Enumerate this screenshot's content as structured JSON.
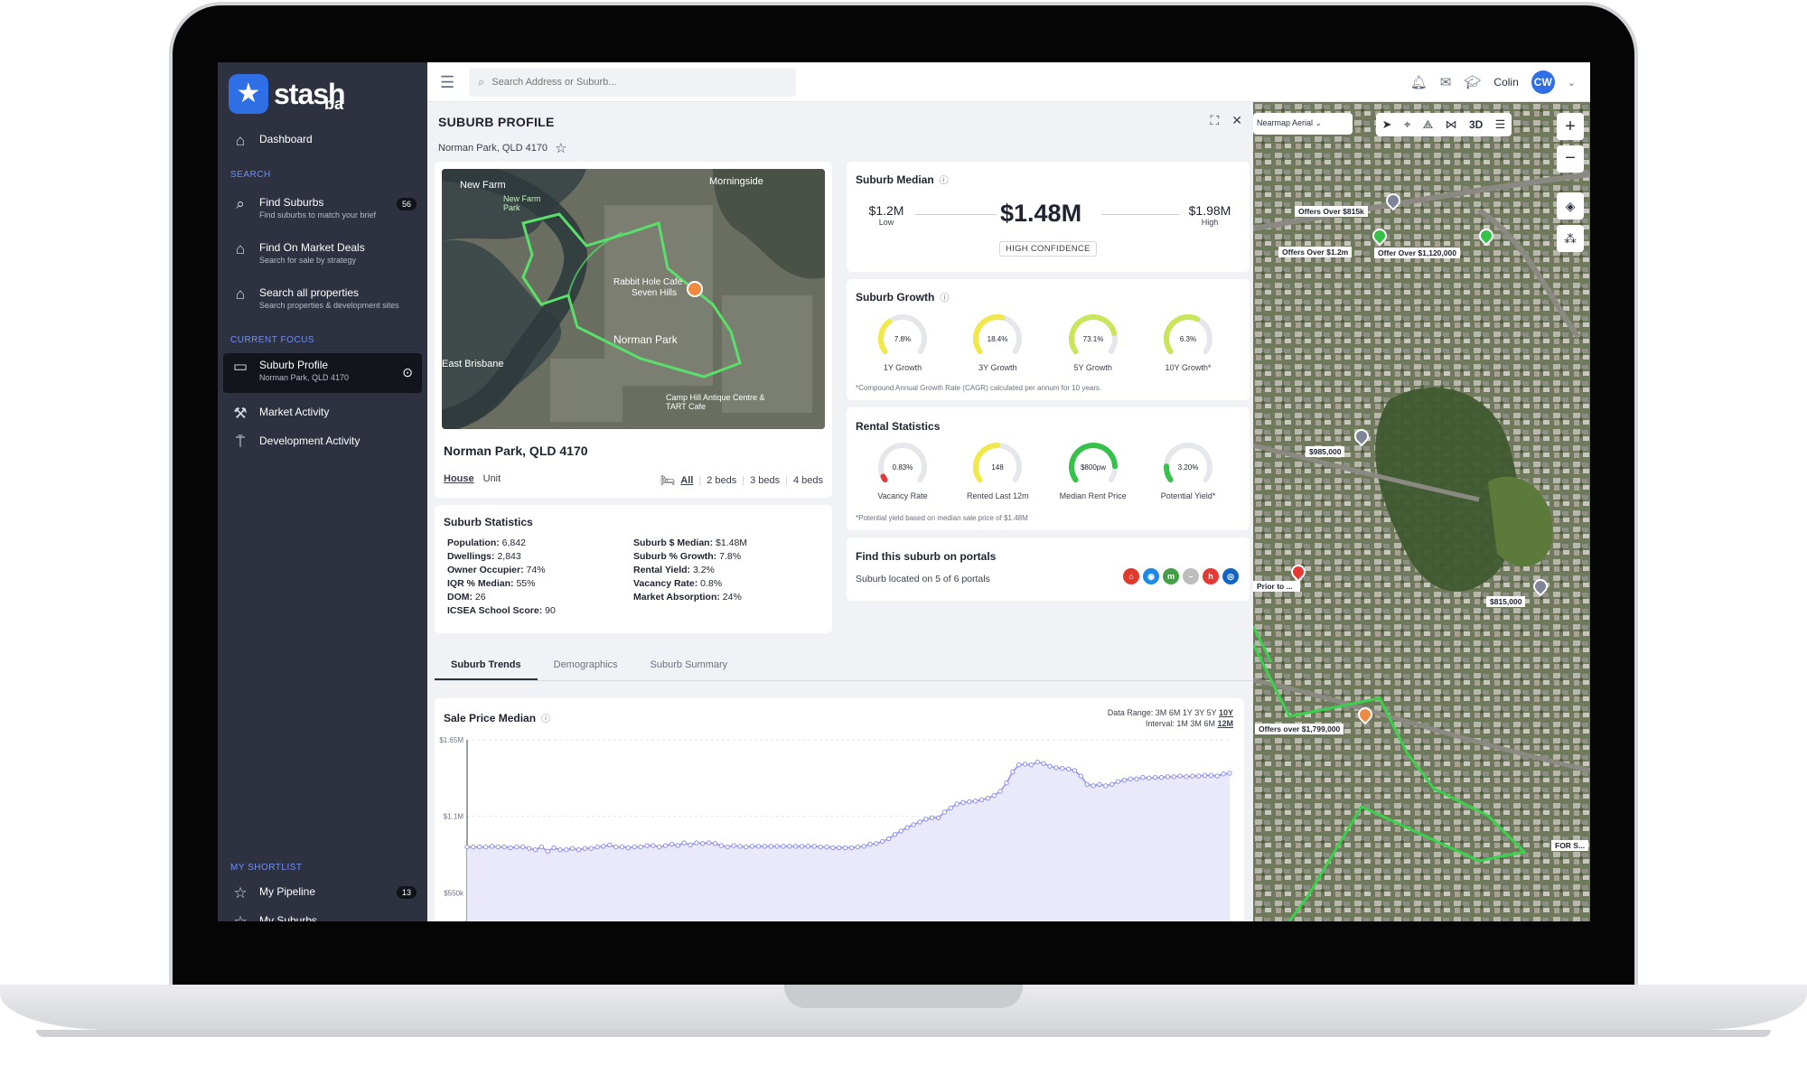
{
  "brand": {
    "name": "stash",
    "suffix": "ba"
  },
  "sidebar": {
    "dashboard": "Dashboard",
    "search_section": "SEARCH",
    "find_suburbs": {
      "label": "Find Suburbs",
      "sub": "Find suburbs to match your brief",
      "count": "56"
    },
    "market_deals": {
      "label": "Find On Market Deals",
      "sub": "Search for sale by strategy"
    },
    "all_properties": {
      "label": "Search all properties",
      "sub": "Search properties & development sites"
    },
    "focus_section": "CURRENT FOCUS",
    "suburb_profile": {
      "label": "Suburb Profile",
      "sub": "Norman Park, QLD 4170"
    },
    "market_activity": "Market Activity",
    "development_activity": "Development Activity",
    "shortlist_section": "MY SHORTLIST",
    "my_pipeline": {
      "label": "My Pipeline",
      "count": "13"
    },
    "my_suburbs": {
      "label": "My Suburbs"
    }
  },
  "topbar": {
    "search_placeholder": "Search Address or Suburb...",
    "user": "Colin",
    "initials": "CW"
  },
  "header": {
    "title": "SUBURB PROFILE",
    "location": "Norman Park, QLD 4170"
  },
  "property": {
    "title": "Norman Park, QLD 4170",
    "types": [
      "House",
      "Unit"
    ],
    "beds": [
      "All",
      "2 beds",
      "3 beds",
      "4 beds"
    ],
    "map_labels": [
      "New Farm",
      "New Farm Park",
      "Morningside",
      "Rabbit Hole Cafe",
      "Seven Hills",
      "Norman Park",
      "East Brisbane",
      "Camp Hill Antique Centre & TART Cafe"
    ]
  },
  "median": {
    "title": "Suburb Median",
    "low": "$1.2M",
    "low_label": "Low",
    "value": "$1.48M",
    "high": "$1.98M",
    "high_label": "High",
    "confidence": "HIGH CONFIDENCE"
  },
  "growth": {
    "title": "Suburb Growth",
    "gauges": [
      {
        "value": "7.8%",
        "label": "1Y Growth",
        "pct": 0.35,
        "color": "#f1e84b"
      },
      {
        "value": "18.4%",
        "label": "3Y Growth",
        "pct": 0.55,
        "color": "#f1e84b"
      },
      {
        "value": "73.1%",
        "label": "5Y Growth",
        "pct": 0.8,
        "color": "#c9e55a"
      },
      {
        "value": "6.3%",
        "label": "10Y Growth*",
        "pct": 0.6,
        "color": "#c9e55a"
      }
    ],
    "footnote": "*Compound Annual Growth Rate (CAGR) calculated per annum for 10 years."
  },
  "rental": {
    "title": "Rental Statistics",
    "gauges": [
      {
        "value": "0.83%",
        "label": "Vacancy Rate",
        "pct": 0.04,
        "color": "#e53935"
      },
      {
        "value": "148",
        "label": "Rented Last 12m",
        "pct": 0.5,
        "color": "#f1e84b"
      },
      {
        "value": "$800pw",
        "label": "Median Rent Price",
        "pct": 0.85,
        "color": "#35c14a"
      },
      {
        "value": "3.20%",
        "label": "Potential Yield*",
        "pct": 0.15,
        "color": "#35c14a"
      }
    ],
    "footnote": "*Potential yield based on median sale price of $1.48M"
  },
  "portals": {
    "title": "Find this suburb on portals",
    "sub": "Suburb located on 5 of 6 portals",
    "icons": [
      {
        "name": "realestate-portal-icon",
        "glyph": "⌂",
        "color": "#e03a2f"
      },
      {
        "name": "domain-portal-icon",
        "glyph": "◉",
        "color": "#1e88e5"
      },
      {
        "name": "homely-portal-icon",
        "glyph": "m",
        "color": "#43a047"
      },
      {
        "name": "unlisted-portal-icon",
        "glyph": "–",
        "color": "#bdbdbd"
      },
      {
        "name": "homes-portal-icon",
        "glyph": "h",
        "color": "#e53935"
      },
      {
        "name": "allhomes-portal-icon",
        "glyph": "◎",
        "color": "#1565c0"
      }
    ]
  },
  "stats": {
    "title": "Suburb Statistics",
    "left": [
      {
        "k": "Population:",
        "v": "6,842"
      },
      {
        "k": "Dwellings:",
        "v": "2,843"
      },
      {
        "k": "Owner Occupier:",
        "v": "74%"
      },
      {
        "k": "IQR % Median:",
        "v": "55%"
      },
      {
        "k": "DOM:",
        "v": "26"
      },
      {
        "k": "ICSEA School Score:",
        "v": "90"
      }
    ],
    "right": [
      {
        "k": "Suburb $ Median:",
        "v": "$1.48M"
      },
      {
        "k": "Suburb % Growth:",
        "v": "7.8%"
      },
      {
        "k": "Rental Yield:",
        "v": "3.2%"
      },
      {
        "k": "Vacancy Rate:",
        "v": "0.8%"
      },
      {
        "k": "Market Absorption:",
        "v": "24%"
      }
    ]
  },
  "tabs": [
    "Suburb Trends",
    "Demographics",
    "Suburb Summary"
  ],
  "trend": {
    "title": "Sale Price Median",
    "range_label": "Data Range:",
    "ranges": [
      "3M",
      "6M",
      "1Y",
      "3Y",
      "5Y",
      "10Y"
    ],
    "interval_label": "Interval:",
    "intervals": [
      "1M",
      "3M",
      "6M",
      "12M"
    ]
  },
  "chart_data": {
    "type": "area",
    "title": "Sale Price Median",
    "ytick_labels": [
      "$1.65M",
      "$1.1M",
      "$550k"
    ],
    "yticks": [
      1650000,
      1100000,
      550000
    ],
    "ylim": [
      300000,
      1650000
    ],
    "values": [
      880000,
      880000,
      880000,
      880000,
      885000,
      880000,
      880000,
      875000,
      880000,
      880000,
      870000,
      860000,
      880000,
      850000,
      875000,
      860000,
      860000,
      870000,
      860000,
      870000,
      870000,
      880000,
      885000,
      895000,
      880000,
      880000,
      875000,
      880000,
      880000,
      890000,
      890000,
      880000,
      890000,
      900000,
      890000,
      910000,
      895000,
      910000,
      905000,
      910000,
      905000,
      890000,
      880000,
      890000,
      885000,
      880000,
      885000,
      885000,
      885000,
      885000,
      885000,
      885000,
      885000,
      885000,
      885000,
      885000,
      885000,
      880000,
      880000,
      875000,
      875000,
      875000,
      875000,
      880000,
      885000,
      900000,
      905000,
      920000,
      940000,
      970000,
      995000,
      1020000,
      1040000,
      1060000,
      1080000,
      1090000,
      1090000,
      1130000,
      1160000,
      1190000,
      1200000,
      1205000,
      1210000,
      1220000,
      1230000,
      1250000,
      1280000,
      1340000,
      1420000,
      1470000,
      1475000,
      1470000,
      1490000,
      1480000,
      1460000,
      1450000,
      1445000,
      1440000,
      1430000,
      1390000,
      1330000,
      1320000,
      1330000,
      1320000,
      1330000,
      1350000,
      1360000,
      1370000,
      1370000,
      1380000,
      1375000,
      1380000,
      1380000,
      1385000,
      1385000,
      1390000,
      1385000,
      1390000,
      1390000,
      1395000,
      1395000,
      1390000,
      1405000,
      1410000
    ],
    "color": "#8e8ef0",
    "grid": true
  },
  "map": {
    "layer": "Nearmap Aerial",
    "zoom_in": "+",
    "zoom_out": "−",
    "three_d": "3D",
    "labels": [
      "Offers Over $815k",
      "Offers Over $1.2m",
      "Offer Over $1,120,000",
      "$985,000",
      "Prior to Auction",
      "$815,000",
      "Offers over $1,799,000",
      "FOR SALE",
      "For Sale"
    ],
    "sale_label_partial": [
      "Offers Over $815k",
      "Offers Over $1.2m",
      "Offer Over $1,120,000",
      "$985,000",
      "Prior to ...",
      "$815,000",
      "Offers over $1,799,000",
      "FOR S..."
    ]
  }
}
